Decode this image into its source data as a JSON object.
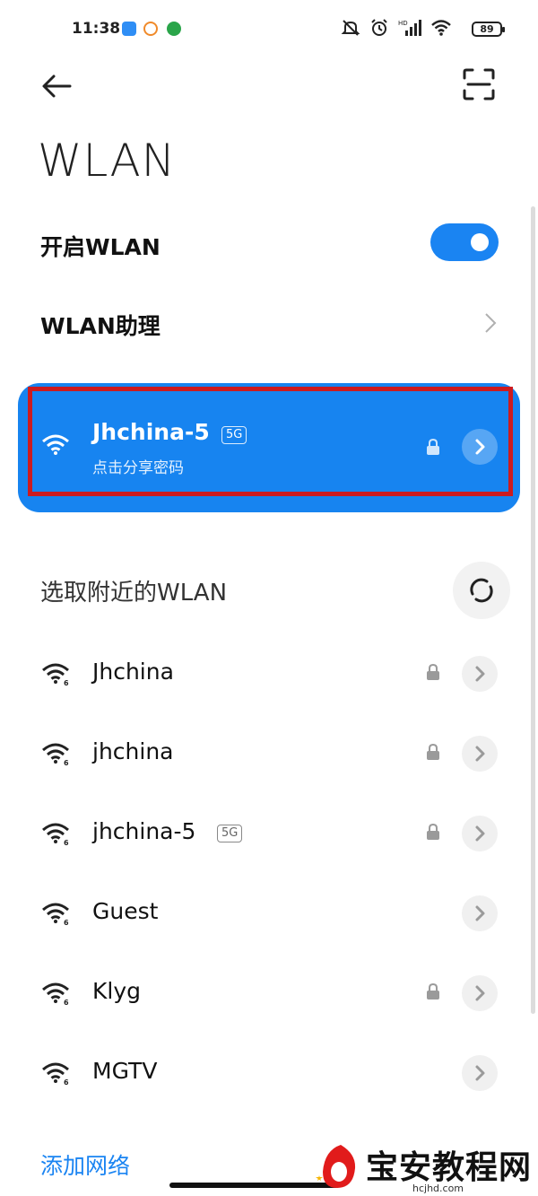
{
  "status_bar": {
    "time": "11:38",
    "battery": "89",
    "icons": [
      "app-icon-1",
      "app-icon-2",
      "app-icon-3",
      "mute-icon",
      "alarm-icon",
      "signal-icon",
      "wifi-icon"
    ]
  },
  "header": {
    "title": "WLAN"
  },
  "wlan_toggle": {
    "label": "开启WLAN",
    "on": true
  },
  "assistant": {
    "label": "WLAN助理"
  },
  "connected": {
    "name": "Jhchina-5",
    "badge": "5G",
    "subtitle": "点击分享密码",
    "locked": true
  },
  "nearby": {
    "title": "选取附近的WLAN",
    "networks": [
      {
        "name": "Jhchina",
        "badge": "",
        "locked": true,
        "wifi": "wifi6"
      },
      {
        "name": "jhchina",
        "badge": "",
        "locked": true,
        "wifi": "wifi6"
      },
      {
        "name": "jhchina-5",
        "badge": "5G",
        "locked": true,
        "wifi": "wifi6"
      },
      {
        "name": "Guest",
        "badge": "",
        "locked": false,
        "wifi": "wifi6"
      },
      {
        "name": "Klyg",
        "badge": "",
        "locked": true,
        "wifi": "wifi6"
      },
      {
        "name": "MGTV",
        "badge": "",
        "locked": false,
        "wifi": "wifi6"
      }
    ]
  },
  "add_network": {
    "label": "添加网络"
  },
  "watermark": {
    "text": "宝安教程网",
    "url": "hcjhd.com"
  },
  "colors": {
    "accent": "#1a84f2",
    "card": "#1784f0",
    "highlight": "#cc1b1f"
  }
}
